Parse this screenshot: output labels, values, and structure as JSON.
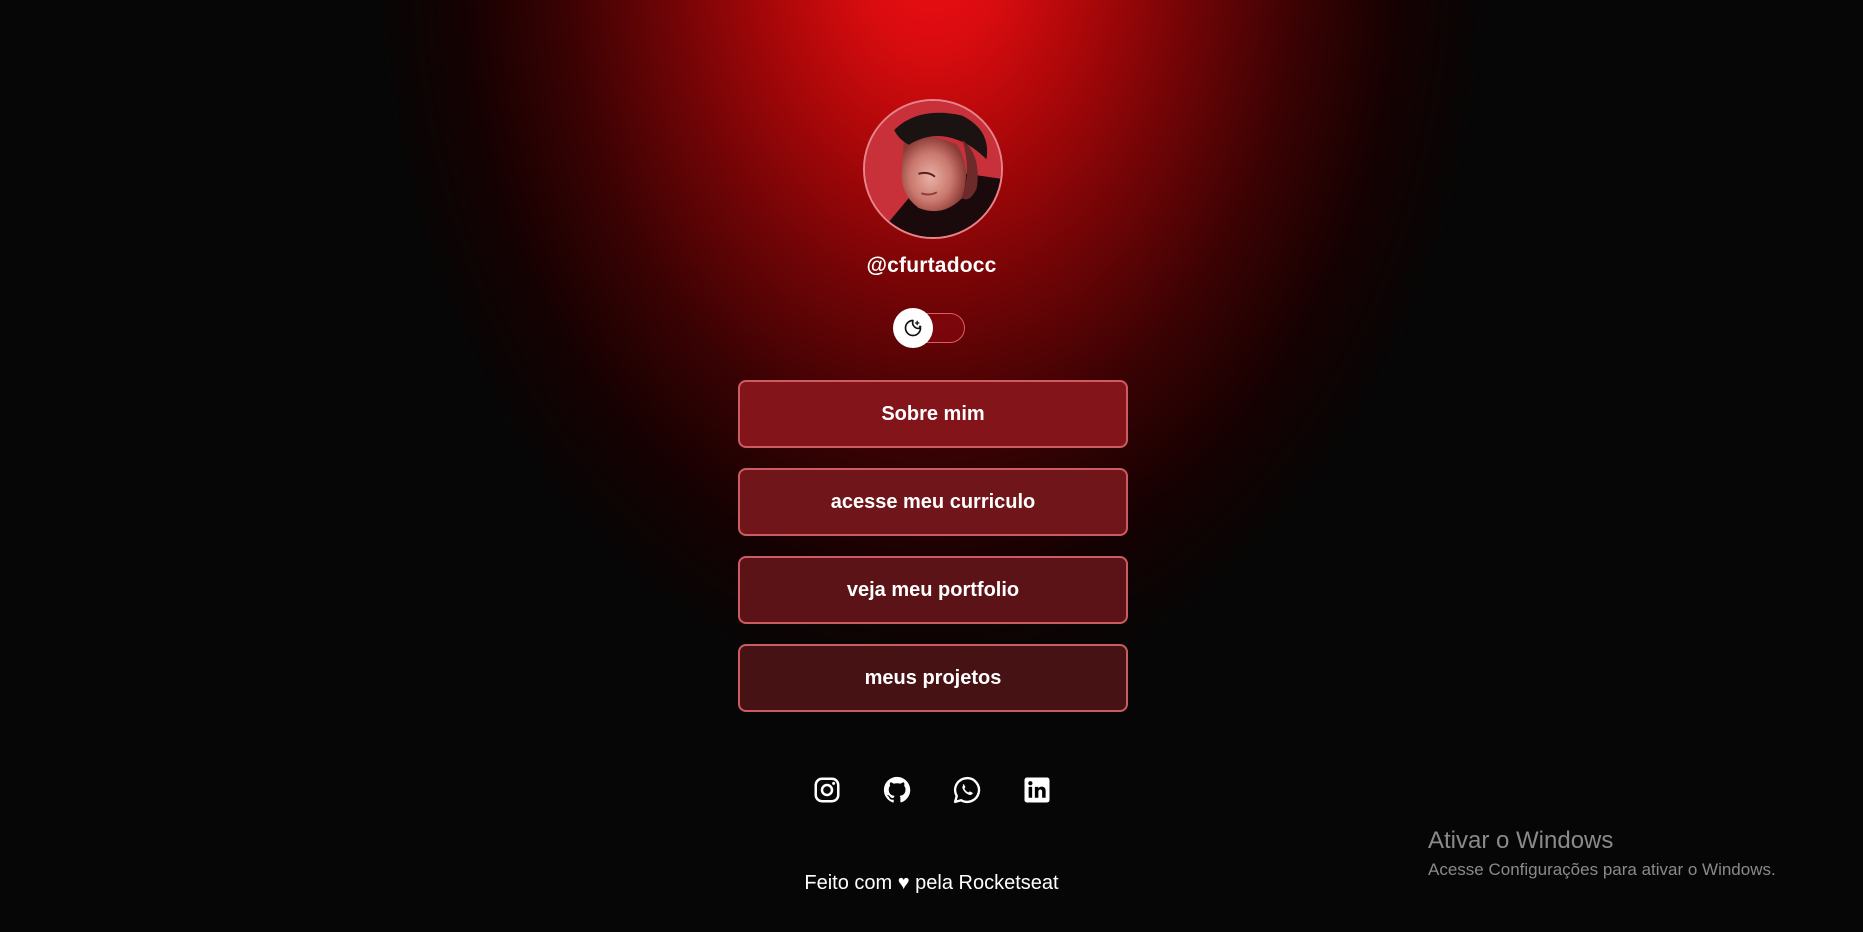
{
  "profile": {
    "handle": "@cfurtadocc",
    "avatar_alt": "profile-photo"
  },
  "theme_toggle": {
    "icon": "moon-stars-icon",
    "state": "dark"
  },
  "links": [
    {
      "label": "Sobre mim"
    },
    {
      "label": "acesse meu curriculo"
    },
    {
      "label": "veja meu portfolio"
    },
    {
      "label": "meus projetos"
    }
  ],
  "social": [
    {
      "icon": "instagram-icon"
    },
    {
      "icon": "github-icon"
    },
    {
      "icon": "whatsapp-icon"
    },
    {
      "icon": "linkedin-icon"
    }
  ],
  "footer": {
    "text": "Feito com ♥ pela Rocketseat"
  },
  "windows_watermark": {
    "title": "Ativar o Windows",
    "subtitle": "Acesse Configurações para ativar o Windows."
  },
  "colors": {
    "accent": "#f10e12",
    "background": "#060606",
    "button_border": "#cc5c62"
  }
}
